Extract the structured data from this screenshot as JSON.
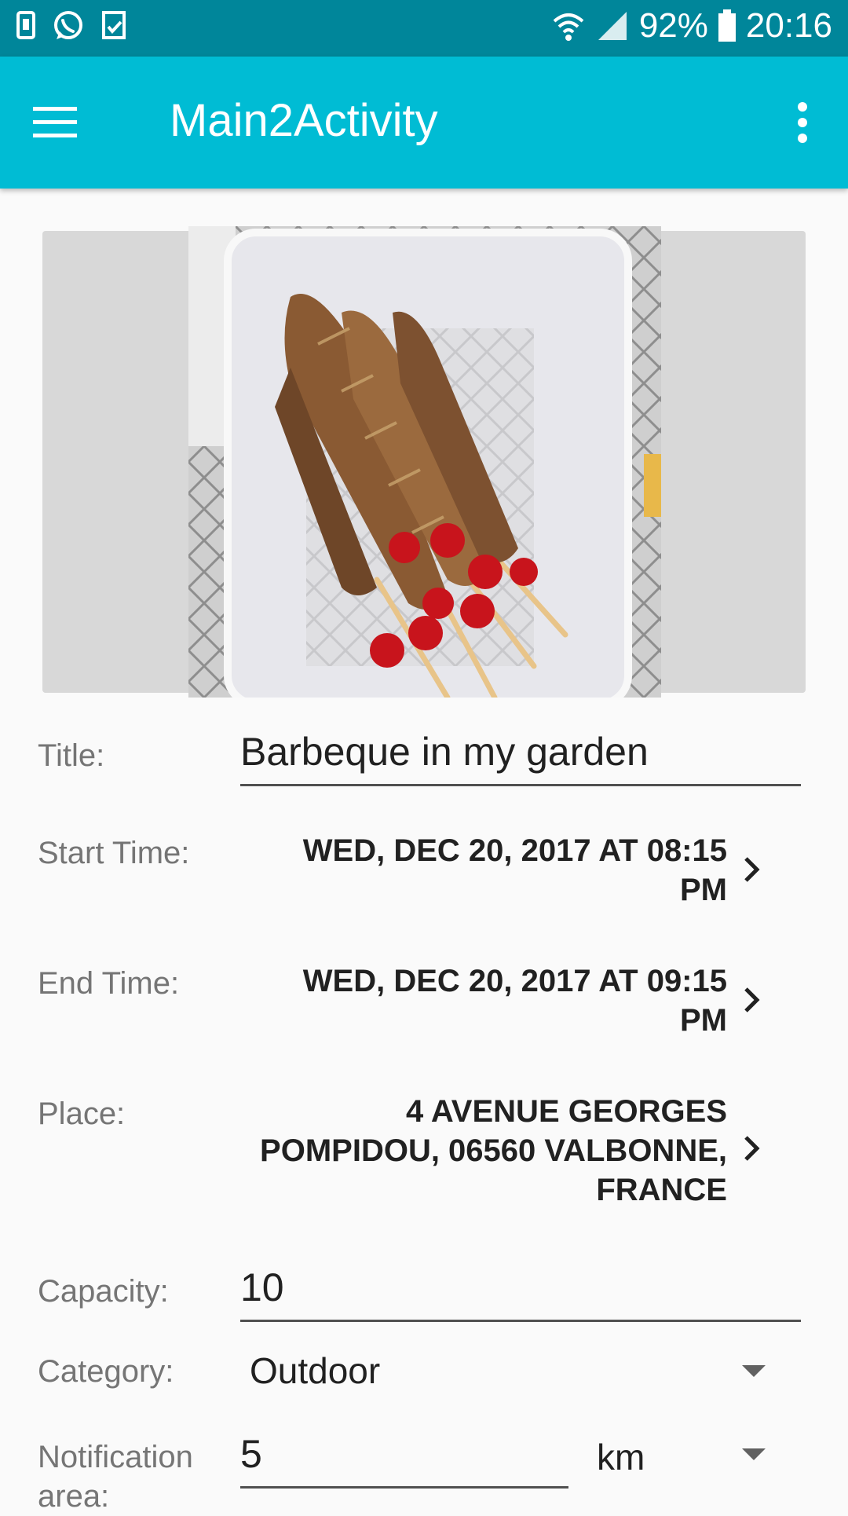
{
  "status_bar": {
    "battery": "92%",
    "time": "20:16",
    "icons": [
      "sim-icon",
      "whatsapp-icon",
      "sync-icon",
      "wifi-icon",
      "signal-icon",
      "battery-icon"
    ]
  },
  "app_bar": {
    "title": "Main2Activity",
    "menu_icon": "hamburger-menu-icon",
    "overflow_icon": "more-vert-icon"
  },
  "form": {
    "title_label": "Title:",
    "title_value": "Barbeque in my garden",
    "start_label": "Start Time:",
    "start_line1": "WED, DEC 20, 2017 AT 08:15",
    "start_line2": "PM",
    "end_label": "End Time:",
    "end_line1": "WED, DEC 20, 2017 AT 09:15",
    "end_line2": "PM",
    "place_label": "Place:",
    "place_line1": "4 AVENUE GEORGES",
    "place_line2": "POMPIDOU, 06560 VALBONNE,",
    "place_line3": "FRANCE",
    "capacity_label": "Capacity:",
    "capacity_value": "10",
    "category_label": "Category:",
    "category_value": "Outdoor",
    "notification_label": "Notification area:",
    "notification_value": "5",
    "unit_value": "km"
  },
  "colors": {
    "status_bar": "#00869a",
    "app_bar": "#00bcd4",
    "background": "#fafafa"
  }
}
